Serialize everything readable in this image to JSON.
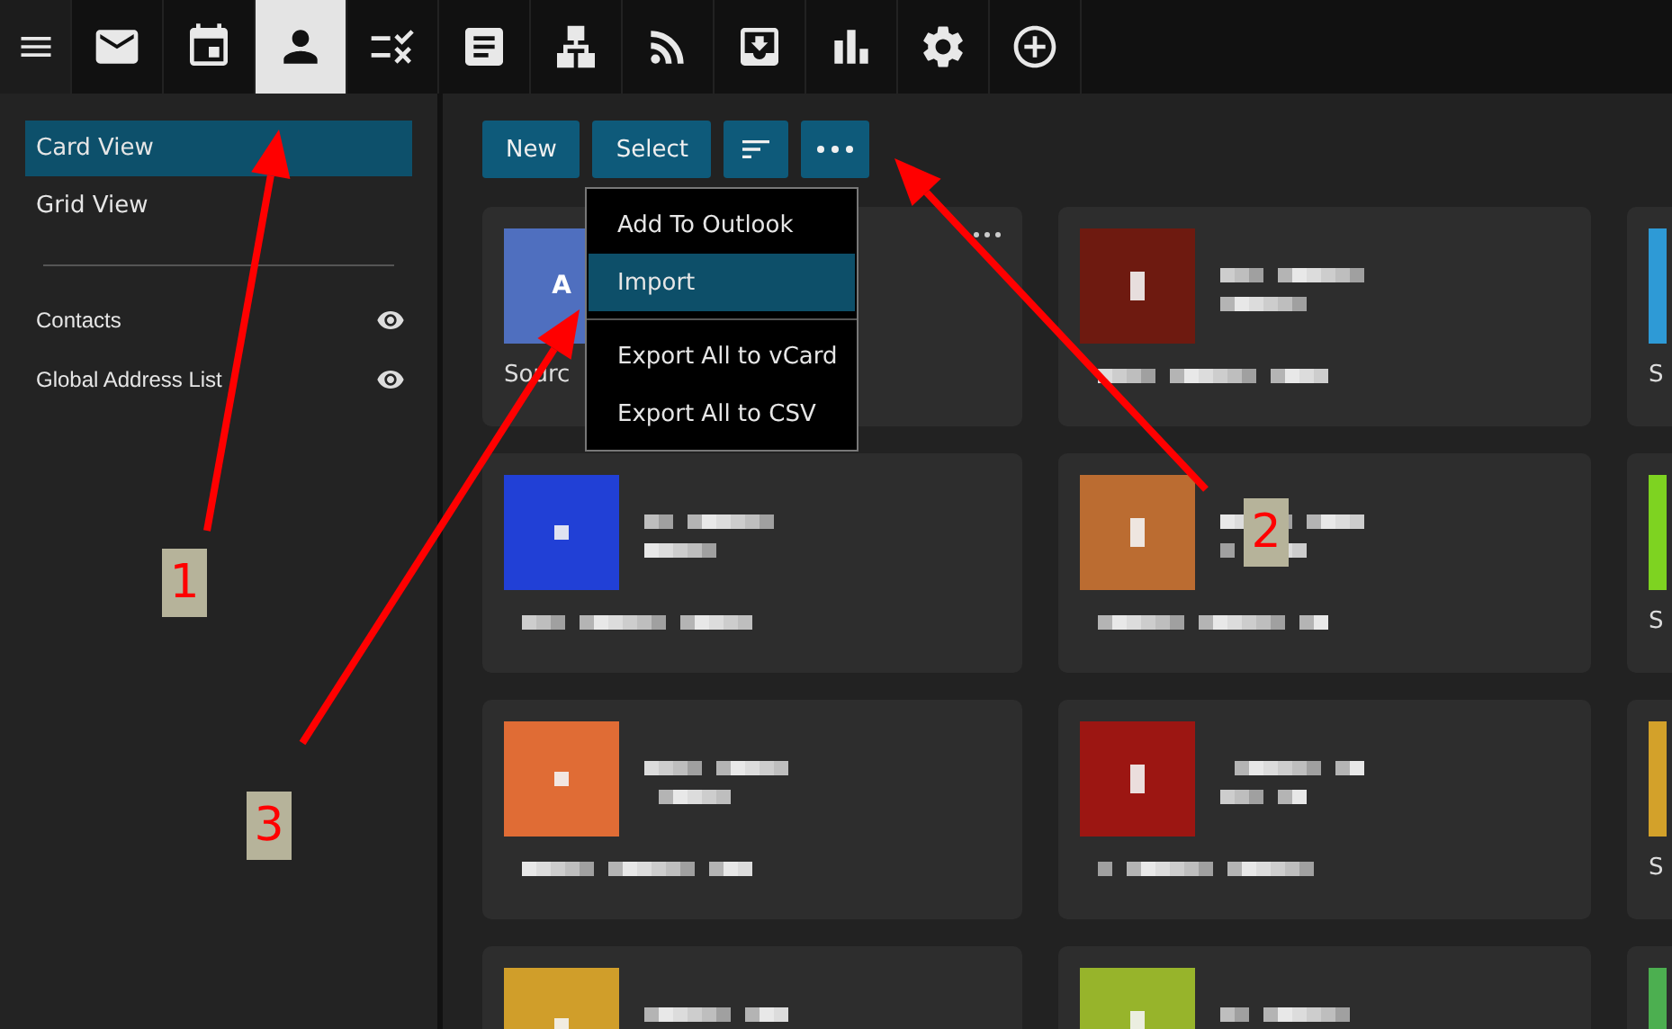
{
  "nav": [
    {
      "kind": "menu",
      "selected": false
    },
    {
      "kind": "mail",
      "selected": false
    },
    {
      "kind": "calendar",
      "selected": false
    },
    {
      "kind": "person",
      "selected": true
    },
    {
      "kind": "tasks",
      "selected": false
    },
    {
      "kind": "notes",
      "selected": false
    },
    {
      "kind": "org",
      "selected": false
    },
    {
      "kind": "rss",
      "selected": false
    },
    {
      "kind": "inbox",
      "selected": false
    },
    {
      "kind": "chart",
      "selected": false
    },
    {
      "kind": "settings",
      "selected": false
    },
    {
      "kind": "add",
      "selected": false
    }
  ],
  "sidebar": {
    "views": [
      {
        "label": "Card View",
        "selected": true
      },
      {
        "label": "Grid View",
        "selected": false
      }
    ],
    "folders": [
      {
        "label": "Contacts"
      },
      {
        "label": "Global Address List"
      }
    ]
  },
  "toolbar": {
    "buttons": [
      {
        "kind": "text",
        "label": "New"
      },
      {
        "kind": "text",
        "label": "Select"
      },
      {
        "kind": "sort"
      },
      {
        "kind": "more"
      }
    ]
  },
  "menu": {
    "groups": [
      [
        {
          "label": "Add To Outlook",
          "selected": false
        },
        {
          "label": "Import",
          "selected": true
        }
      ],
      [
        {
          "label": "Export All to vCard",
          "selected": false
        },
        {
          "label": "Export All to CSV",
          "selected": false
        }
      ]
    ]
  },
  "cards": [
    {
      "kind": "visible",
      "color": "#4f6fbf",
      "initial": "A",
      "label": "Sourc"
    },
    {
      "kind": "redacted",
      "color": "#6e1a10"
    },
    {
      "kind": "clipped",
      "color": "#2e9ad6",
      "label": "S"
    },
    {
      "kind": "redacted",
      "color": "#2140d6"
    },
    {
      "kind": "redacted",
      "color": "#bb6c31"
    },
    {
      "kind": "clipped",
      "color": "#7ed321",
      "label": "S"
    },
    {
      "kind": "redacted",
      "color": "#e06c35"
    },
    {
      "kind": "redacted",
      "color": "#9c1612"
    },
    {
      "kind": "clipped",
      "color": "#d3a12a",
      "label": "S"
    },
    {
      "kind": "redacted",
      "color": "#d09e2a"
    },
    {
      "kind": "redacted",
      "color": "#97b42b"
    },
    {
      "kind": "clipped",
      "color": "#4caf50"
    }
  ],
  "annotations": [
    {
      "number": "1"
    },
    {
      "number": "2"
    },
    {
      "number": "3"
    }
  ]
}
